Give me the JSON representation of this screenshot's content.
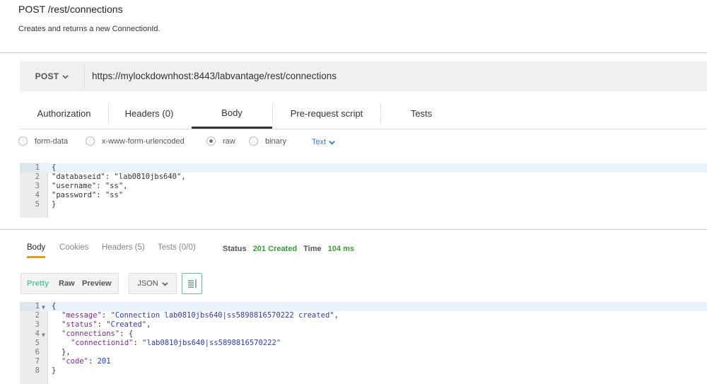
{
  "request": {
    "title": "POST /rest/connections",
    "description": "Creates and returns a new ConnectionId.",
    "method": "POST",
    "url": "https://mylockdownhost:8443/labvantage/rest/connections"
  },
  "tabs": [
    {
      "label": "Authorization"
    },
    {
      "label": "Headers (0)"
    },
    {
      "label": "Body"
    },
    {
      "label": "Pre-request script"
    },
    {
      "label": "Tests"
    }
  ],
  "active_tab": "Body",
  "body_modes": [
    {
      "label": "form-data",
      "selected": false
    },
    {
      "label": "x-www-form-urlencoded",
      "selected": false
    },
    {
      "label": "raw",
      "selected": true
    },
    {
      "label": "binary",
      "selected": false
    }
  ],
  "raw_format": "Text",
  "request_body": {
    "line_numbers": [
      "1",
      "2",
      "3",
      "4",
      "5"
    ],
    "lines": [
      "{",
      "\"databaseid\": \"lab0810jbs640\",",
      "\"username\": \"ss\",",
      "\"password\": \"ss\"",
      "}"
    ]
  },
  "response": {
    "tabs": [
      {
        "label": "Body"
      },
      {
        "label": "Cookies"
      },
      {
        "label": "Headers (5)"
      },
      {
        "label": "Tests (0/0)"
      }
    ],
    "status_label": "Status",
    "status_value": "201 Created",
    "time_label": "Time",
    "time_value": "104 ms",
    "view_buttons": [
      "Pretty",
      "Raw",
      "Preview"
    ],
    "format": "JSON",
    "line_numbers": [
      "1",
      "2",
      "3",
      "4",
      "5",
      "6",
      "7",
      "8"
    ],
    "json": {
      "open": "{",
      "message_key": "\"message\"",
      "message_val": "\"Connection lab0810jbs640|ss5898816570222 created\"",
      "status_key": "\"status\"",
      "status_val": "\"Created\"",
      "connections_key": "\"connections\"",
      "connections_open": "{",
      "connectionid_key": "\"connectionid\"",
      "connectionid_val": "\"lab0810jbs640|ss5898816570222\"",
      "connections_close": "},",
      "code_key": "\"code\"",
      "code_val": "201",
      "close": "}"
    }
  },
  "colors": {
    "accent_green": "#5ec49a",
    "status_green": "#3a9a3a",
    "tab_underline": "#e0a11e",
    "link_blue": "#3578c6"
  }
}
